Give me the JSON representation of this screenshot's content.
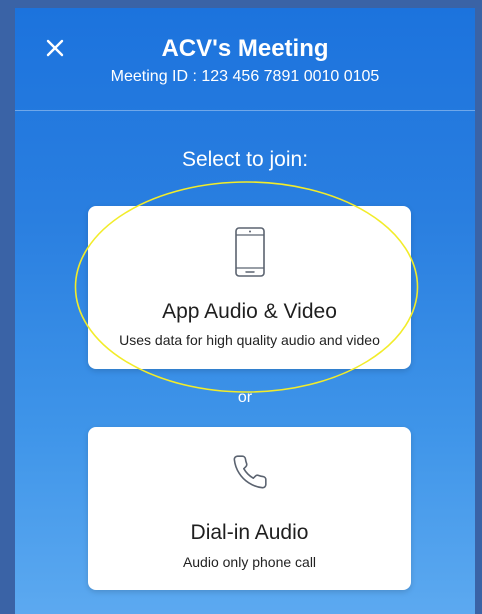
{
  "header": {
    "title": "ACV's Meeting",
    "meeting_id": "Meeting ID : 123 456 7891 0010 0105",
    "close_icon": "close-icon"
  },
  "prompt": "Select to join:",
  "options": [
    {
      "icon": "smartphone-icon",
      "title": "App Audio & Video",
      "description": "Uses data for high quality audio and video"
    },
    {
      "icon": "phone-handset-icon",
      "title": "Dial-in Audio",
      "description": "Audio only phone call"
    }
  ],
  "separator": "or",
  "colors": {
    "background_top": "#1c73dd",
    "background_bottom": "#5ca9f0",
    "card": "#ffffff",
    "icon_stroke": "#5b6370",
    "annotation": "#f2ec2a"
  }
}
